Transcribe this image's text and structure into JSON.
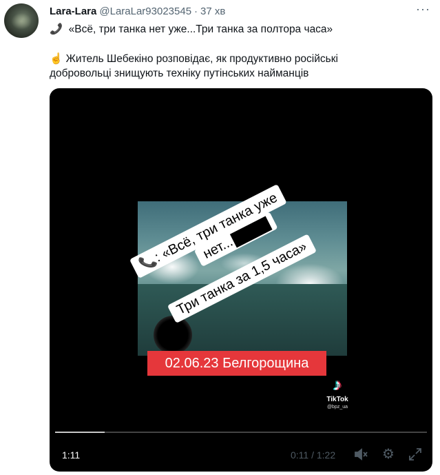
{
  "tweet": {
    "display_name": "Lara-Lara",
    "handle": "@LaraLar93023545",
    "separator": "·",
    "time": "37 хв",
    "more_label": "···",
    "line1": "«Всё, три танка нет уже...Три танка за полтора часа»",
    "line2": "Житель Шебекіно розповідає, як продуктивно російські",
    "line3": "добровольці знищують техніку путінських найманців",
    "icons": {
      "line1": "phone-icon",
      "line2": "pointing-up-hand-icon"
    }
  },
  "video": {
    "sticker_line1": "📞: «Всё, три танка уже",
    "sticker_line2": "нет...",
    "sticker_line3": "Три танка за 1,5 часа»",
    "date_banner": "02.06.23 Белгорощина",
    "tiktok_logo_label": "TikTok",
    "tiktok_user": "@bpz_ua",
    "elapsed_time": "1:11",
    "duration_text": "0:11 / 1:22",
    "progress_fraction": 0.134,
    "colors": {
      "date_banner_bg": "#e5373b",
      "player_bg": "#000000"
    }
  }
}
